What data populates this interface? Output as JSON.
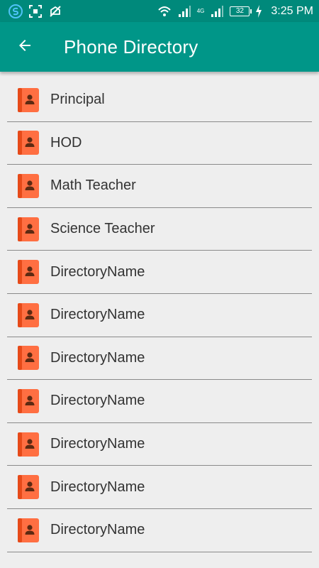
{
  "status_bar": {
    "time": "3:25 PM",
    "battery": "32",
    "network_1": "4G",
    "network_2": "4G"
  },
  "app_bar": {
    "title": "Phone Directory"
  },
  "colors": {
    "primary": "#009688",
    "status": "#00897b",
    "contact_icon": "#ff6f42",
    "contact_icon_spine": "#e64a19"
  },
  "directory": {
    "items": [
      {
        "label": "Principal",
        "icon": "contact-book-icon"
      },
      {
        "label": "HOD",
        "icon": "contact-book-icon"
      },
      {
        "label": "Math Teacher",
        "icon": "contact-book-icon"
      },
      {
        "label": "Science Teacher",
        "icon": "contact-book-icon"
      },
      {
        "label": "DirectoryName",
        "icon": "contact-book-icon"
      },
      {
        "label": "DirectoryName",
        "icon": "contact-book-icon"
      },
      {
        "label": "DirectoryName",
        "icon": "contact-book-icon"
      },
      {
        "label": "DirectoryName",
        "icon": "contact-book-icon"
      },
      {
        "label": "DirectoryName",
        "icon": "contact-book-icon"
      },
      {
        "label": "DirectoryName",
        "icon": "contact-book-icon"
      },
      {
        "label": "DirectoryName",
        "icon": "contact-book-icon"
      }
    ]
  }
}
